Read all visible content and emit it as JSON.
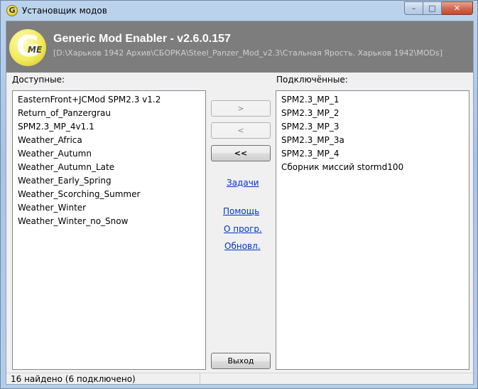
{
  "window": {
    "title": "Установщик модов",
    "icon_letter": "G",
    "minimize_glyph": "–",
    "maximize_glyph": "□",
    "close_glyph": "✕"
  },
  "header": {
    "logo_letter": "G",
    "logo_sub": "ME",
    "app_title": "Generic Mod Enabler - v2.6.0.157",
    "path": "[D:\\Харьков 1942 Архив\\СБОРКА\\Steel_Panzer_Mod_v2.3\\Стальная Ярость. Харьков 1942\\MODs]"
  },
  "available": {
    "label": "Доступные:",
    "items": [
      "EasternFront+JCMod SPM2.3 v1.2",
      "Return_of_Panzergrau",
      "SPM2.3_MP_4v1.1",
      "Weather_Africa",
      "Weather_Autumn",
      "Weather_Autumn_Late",
      "Weather_Early_Spring",
      "Weather_Scorching_Summer",
      "Weather_Winter",
      "Weather_Winter_no_Snow"
    ]
  },
  "connected": {
    "label": "Подключённые:",
    "items": [
      "SPM2.3_MP_1",
      "SPM2.3_MP_2",
      "SPM2.3_MP_3",
      "SPM2.3_MP_3a",
      "SPM2.3_MP_4",
      "Сборник миссий stormd100"
    ]
  },
  "buttons": {
    "add": ">",
    "remove": "<",
    "remove_all": "<<",
    "exit": "Выход"
  },
  "links": {
    "tasks": "Задачи",
    "help": "Помощь",
    "about": "О прогр.",
    "update": "Обновл."
  },
  "status": {
    "text": "16 найдено  (6 подключено)"
  }
}
